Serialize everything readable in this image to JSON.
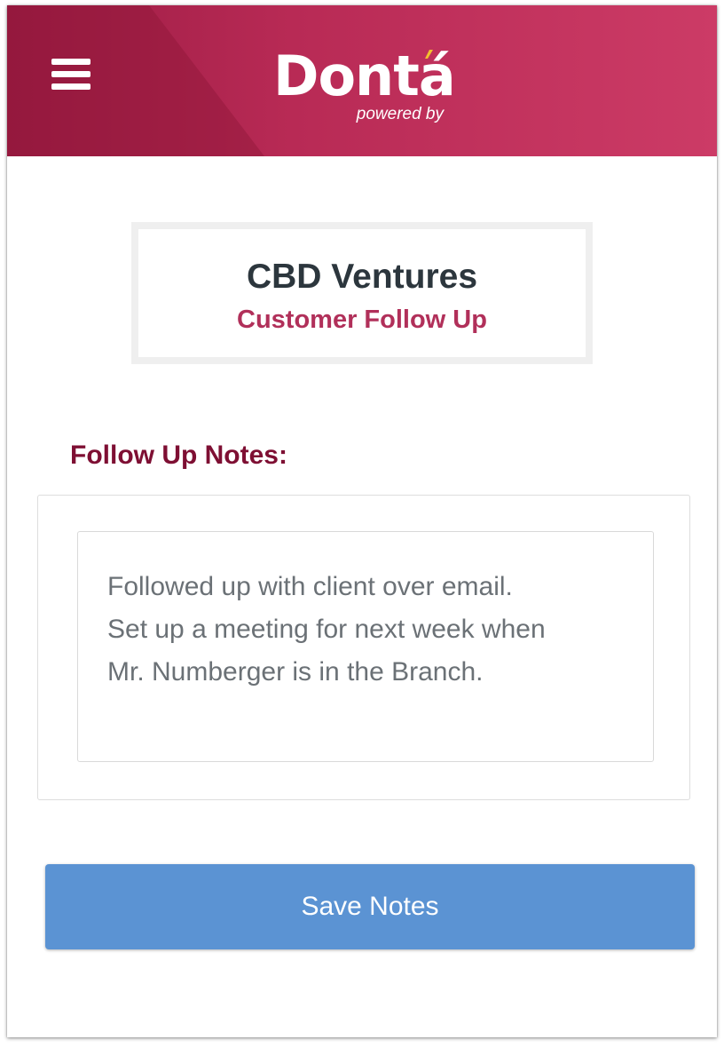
{
  "header": {
    "menu_icon": "hamburger-menu-icon",
    "brand_name": "Dontá",
    "brand_tagline": "powered by",
    "colors": {
      "header_dark": "#9b1b43",
      "header_light": "#cc3b66",
      "accent_mark": "#f2c12e"
    }
  },
  "title_card": {
    "company": "CBD Ventures",
    "subtitle": "Customer Follow Up"
  },
  "notes": {
    "label": "Follow Up Notes:",
    "lines": [
      "Followed up with client over email.",
      "Set up a meeting for next week when",
      "Mr. Numberger is in the Branch."
    ]
  },
  "actions": {
    "save_label": "Save Notes",
    "save_color": "#5b93d3"
  }
}
